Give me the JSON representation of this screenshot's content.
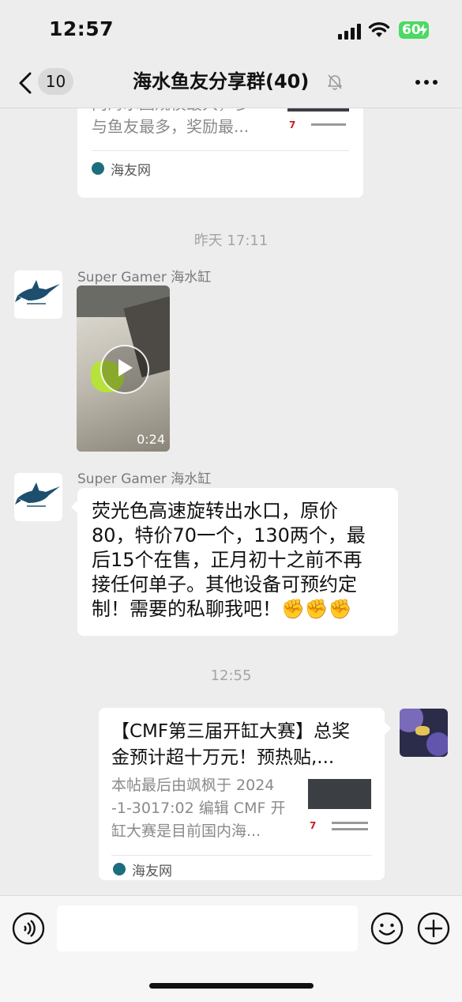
{
  "status_bar": {
    "time": "12:57",
    "battery": "60"
  },
  "header": {
    "back_count": "10",
    "title": "海水鱼友分享群(40)"
  },
  "messages": {
    "top_card": {
      "snippet_line1": "内海水圈规模最大，参",
      "snippet_line2": "与鱼友最多，奖励最...",
      "source": "海友网"
    },
    "time_yesterday": "昨天 17:11",
    "video_msg": {
      "sender": "Super Gamer 海水缸",
      "duration": "0:24"
    },
    "text_msg": {
      "sender": "Super Gamer 海水缸",
      "lines": [
        "荧光色高速旋转出水口，原价",
        "80，特价70一个，130两个，最",
        "后15个在售，正月初十之前不再",
        "接任何单子。其他设备可预约定",
        "制！需要的私聊我吧！✊✊✊"
      ]
    },
    "time_now": "12:55",
    "my_card": {
      "title_line1": "【CMF第三届开缸大赛】总奖",
      "title_line2": "金预计超十万元！预热贴,...",
      "desc_line1": "本帖最后由飒枫于 2024",
      "desc_line2": "-1-3017:02 编辑 CMF 开",
      "desc_line3": "缸大赛是目前国内海...",
      "source": "海友网"
    }
  },
  "colors": {
    "background": "#ededed",
    "bubble": "#ffffff",
    "battery": "#4cd964"
  }
}
